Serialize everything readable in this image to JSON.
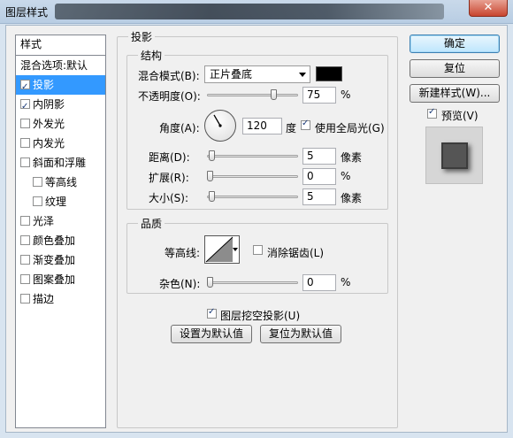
{
  "window": {
    "title": "图层样式",
    "close_glyph": "✕"
  },
  "stylelist": {
    "header": "样式",
    "items": [
      {
        "label": "混合选项:默认",
        "checkbox": false,
        "checked": false,
        "selected": false,
        "sub": false
      },
      {
        "label": "投影",
        "checkbox": true,
        "checked": true,
        "selected": true,
        "sub": false
      },
      {
        "label": "内阴影",
        "checkbox": true,
        "checked": true,
        "selected": false,
        "sub": false
      },
      {
        "label": "外发光",
        "checkbox": true,
        "checked": false,
        "selected": false,
        "sub": false
      },
      {
        "label": "内发光",
        "checkbox": true,
        "checked": false,
        "selected": false,
        "sub": false
      },
      {
        "label": "斜面和浮雕",
        "checkbox": true,
        "checked": false,
        "selected": false,
        "sub": false
      },
      {
        "label": "等高线",
        "checkbox": true,
        "checked": false,
        "selected": false,
        "sub": true
      },
      {
        "label": "纹理",
        "checkbox": true,
        "checked": false,
        "selected": false,
        "sub": true
      },
      {
        "label": "光泽",
        "checkbox": true,
        "checked": false,
        "selected": false,
        "sub": false
      },
      {
        "label": "颜色叠加",
        "checkbox": true,
        "checked": false,
        "selected": false,
        "sub": false
      },
      {
        "label": "渐变叠加",
        "checkbox": true,
        "checked": false,
        "selected": false,
        "sub": false
      },
      {
        "label": "图案叠加",
        "checkbox": true,
        "checked": false,
        "selected": false,
        "sub": false
      },
      {
        "label": "描边",
        "checkbox": true,
        "checked": false,
        "selected": false,
        "sub": false
      }
    ]
  },
  "drop_shadow": {
    "legend": "投影",
    "structure": {
      "legend": "结构",
      "blend_mode_label": "混合模式(B):",
      "blend_mode_value": "正片叠底",
      "shadow_color": "#000000",
      "opacity_label": "不透明度(O):",
      "opacity_value": "75",
      "opacity_level": 0.75,
      "opacity_unit": "%",
      "angle_label": "角度(A):",
      "angle_value": "120",
      "angle_unit": "度",
      "global_light_label": "使用全局光(G)",
      "global_light_checked": true,
      "distance_label": "距离(D):",
      "distance_value": "5",
      "distance_level": 0.02,
      "distance_unit": "像素",
      "spread_label": "扩展(R):",
      "spread_value": "0",
      "spread_level": 0,
      "spread_unit": "%",
      "size_label": "大小(S):",
      "size_value": "5",
      "size_level": 0.02,
      "size_unit": "像素"
    },
    "quality": {
      "legend": "品质",
      "contour_label": "等高线:",
      "antialias_label": "消除锯齿(L)",
      "antialias_checked": false,
      "noise_label": "杂色(N):",
      "noise_value": "0",
      "noise_level": 0,
      "noise_unit": "%"
    },
    "knockout_label": "图层挖空投影(U)",
    "knockout_checked": true,
    "make_default_label": "设置为默认值",
    "reset_default_label": "复位为默认值"
  },
  "actions": {
    "ok_label": "确定",
    "reset_label": "复位",
    "new_style_label": "新建样式(W)...",
    "preview_label": "预览(V)",
    "preview_checked": true
  }
}
